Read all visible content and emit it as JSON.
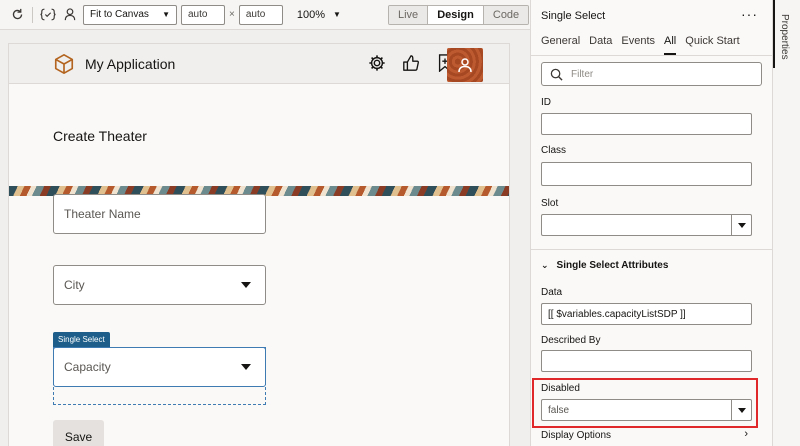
{
  "toolbar": {
    "fit_select": "Fit to Canvas",
    "width": "auto",
    "times": "×",
    "height": "auto",
    "zoom": "100%",
    "modes": [
      "Live",
      "Design",
      "Code"
    ],
    "active_mode": "Design"
  },
  "app": {
    "title": "My Application",
    "page_title": "Create Theater",
    "fields": {
      "theater_name": "Theater Name",
      "city": "City",
      "capacity": "Capacity"
    },
    "selection_tag": "Single Select",
    "save_label": "Save"
  },
  "props": {
    "title": "Single Select",
    "more": "···",
    "tabs": [
      "General",
      "Data",
      "Events",
      "All",
      "Quick Start"
    ],
    "active_tab": "All",
    "filter_placeholder": "Filter",
    "id_label": "ID",
    "class_label": "Class",
    "slot_label": "Slot",
    "section_title": "Single Select Attributes",
    "data_label": "Data",
    "data_value": "[[ $variables.capacityListSDP ]]",
    "described_by_label": "Described By",
    "disabled_label": "Disabled",
    "disabled_value": "false",
    "display_options": "Display Options"
  },
  "vertical_tab": "Properties",
  "colors": {
    "accent": "#1d5f8a",
    "highlight": "#e0282b",
    "avatar": "#b3502a"
  }
}
